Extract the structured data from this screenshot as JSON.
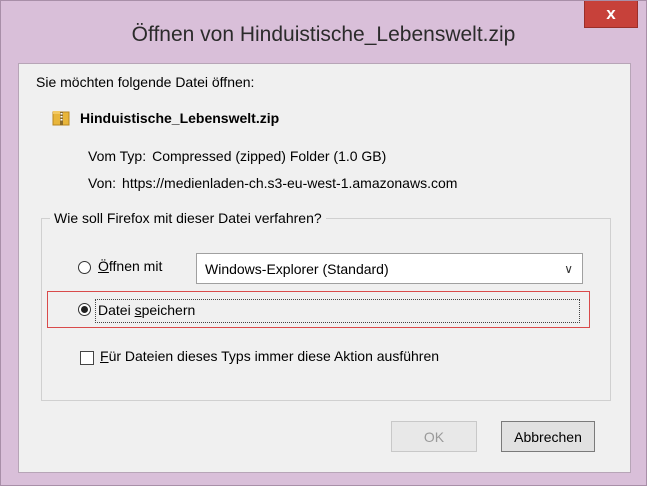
{
  "window": {
    "title": "Öffnen von Hinduistische_Lebenswelt.zip",
    "close_glyph": "x"
  },
  "dialog": {
    "intro": "Sie möchten folgende Datei öffnen:",
    "file": {
      "name": "Hinduistische_Lebenswelt.zip",
      "icon": "zip-folder-icon"
    },
    "type_label": "Vom Typ:",
    "type_value": "Compressed (zipped) Folder (1.0 GB)",
    "from_label": "Von:",
    "from_value": "https://medienladen-ch.s3-eu-west-1.amazonaws.com"
  },
  "action_group": {
    "legend": "Wie soll Firefox mit dieser Datei verfahren?",
    "open_with": {
      "label_prefix": "",
      "label_access_key": "Ö",
      "label_rest": "ffnen mit",
      "checked": false
    },
    "app_select": {
      "value": "Windows-Explorer (Standard)",
      "chevron": "∨"
    },
    "save_file": {
      "label_before": "Datei ",
      "label_access_key": "s",
      "label_after": "peichern",
      "checked": true
    },
    "always_do": {
      "label_access_key": "F",
      "label_rest": "ür Dateien dieses Typs immer diese Aktion ausführen",
      "checked": false
    }
  },
  "buttons": {
    "ok": "OK",
    "cancel": "Abbrechen"
  },
  "colors": {
    "frame": "#d9bfd9",
    "close": "#c7413a",
    "highlight": "#d94a4a"
  }
}
